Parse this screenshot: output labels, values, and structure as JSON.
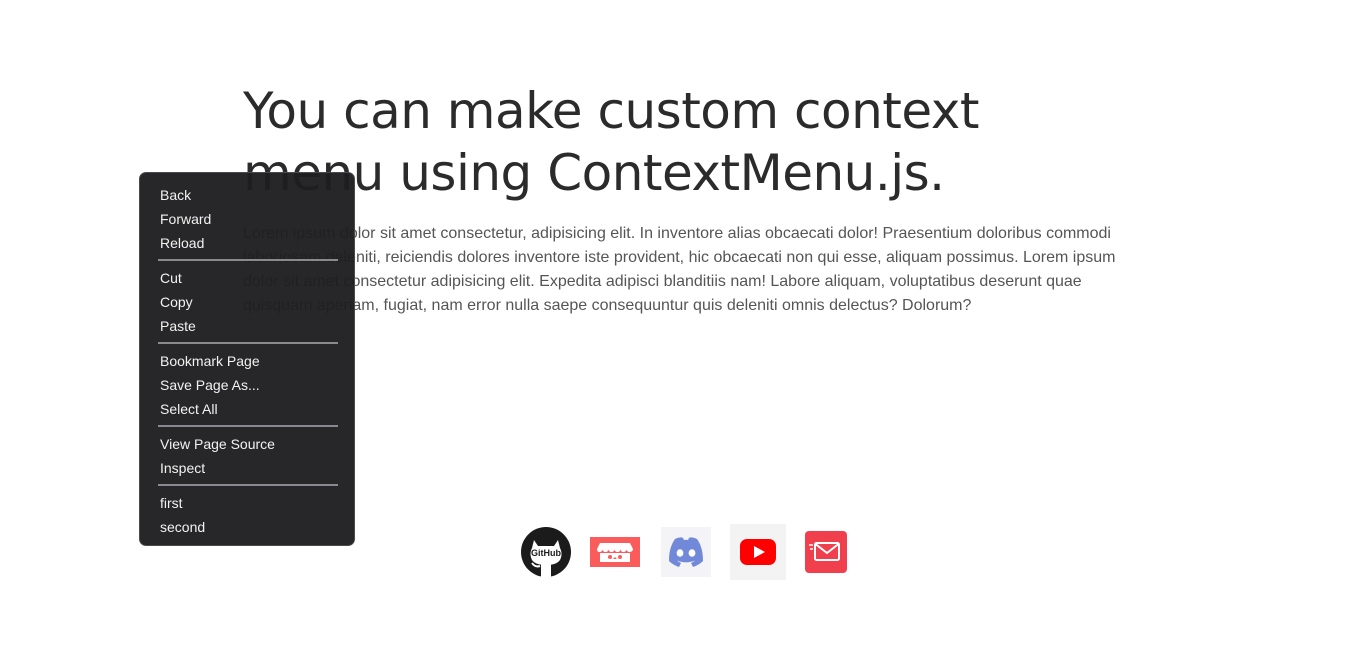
{
  "main": {
    "title": "You can make custom context menu using ContextMenu.js.",
    "paragraph": "Lorem ipsum dolor sit amet consectetur, adipisicing elit. In inventore alias obcaecati dolor! Praesentium doloribus commodi laboriosam deleniti, reiciendis dolores inventore iste provident, hic obcaecati non qui esse, aliquam possimus. Lorem ipsum dolor sit amet consectetur adipisicing elit. Expedita adipisci blanditiis nam! Labore aliquam, voluptatibus deserunt quae quisquam aperiam, fugiat, nam error nulla saepe consequuntur quis deleniti omnis delectus? Dolorum?"
  },
  "context_menu": {
    "groups": [
      [
        "Back",
        "Forward",
        "Reload"
      ],
      [
        "Cut",
        "Copy",
        "Paste"
      ],
      [
        "Bookmark Page",
        "Save Page As...",
        "Select All"
      ],
      [
        "View Page Source",
        "Inspect"
      ],
      [
        "first",
        "second"
      ]
    ]
  },
  "socials": {
    "github_text": "GitHub",
    "icons": [
      "github-icon",
      "itch-icon",
      "discord-icon",
      "youtube-icon",
      "mail-icon"
    ]
  },
  "colors": {
    "menu_bg": "#1e1e20",
    "menu_text": "#f2f2f2",
    "title_text": "#2b2b2b",
    "paragraph_text": "#555555",
    "itch": "#fa5c5c",
    "discord": "#7289da",
    "youtube": "#ff0000",
    "mail": "#f0404e"
  }
}
